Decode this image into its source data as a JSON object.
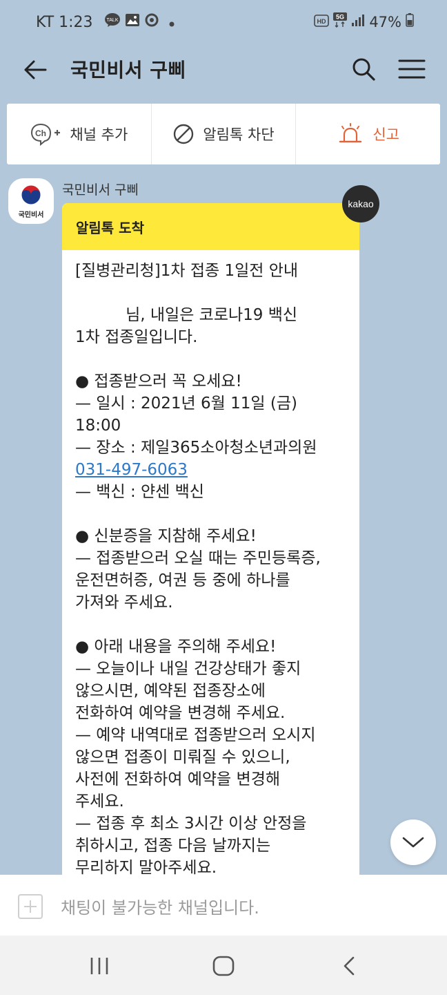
{
  "status_bar": {
    "carrier_time": "KT 1:23",
    "talk_label": "TALK",
    "hd_label": "HD",
    "network": "5G",
    "battery": "47%"
  },
  "header": {
    "title": "국민비서 구삐"
  },
  "actions": {
    "add_channel": "채널 추가",
    "ch_label": "Ch",
    "block": "알림톡 차단",
    "report": "신고"
  },
  "message": {
    "avatar_label": "국민비서",
    "sender": "국민비서 구삐",
    "badge": "kakao",
    "header": "알림톡 도착",
    "lines": [
      "[질병관리청]1차 접종 1일전 안내",
      "",
      "          님, 내일은 코로나19 백신",
      "1차 접종일입니다.",
      "",
      "● 접종받으러 꼭 오세요!",
      "— 일시 : 2021년 6월 11일 (금)",
      "18:00",
      "— 장소 : 제일365소아청소년과의원",
      "031-497-6063",
      "— 백신 : 얀센 백신",
      "",
      "● 신분증을 지참해 주세요!",
      "— 접종받으러 오실 때는 주민등록증,",
      "운전면허증, 여권 등 중에 하나를",
      "가져와 주세요.",
      "",
      "● 아래 내용을 주의해 주세요!",
      "— 오늘이나 내일 건강상태가 좋지",
      "않으시면, 예약된 접종장소에",
      "전화하여 예약을 변경해 주세요.",
      "— 예약 내역대로 접종받으러 오시지",
      "않으면 접종이 미뤄질 수 있으니,",
      "사전에 전화하여 예약을 변경해",
      "주세요.",
      "— 접종 후 최소 3시간 이상 안정을",
      "취하시고, 접종 다음 날까지는",
      "무리하지 말아주세요."
    ]
  },
  "input": {
    "placeholder": "채팅이 불가능한 채널입니다."
  },
  "colors": {
    "chat_background": "#b2c7da",
    "bubble_header": "#fee93b",
    "report_accent": "#e0633a",
    "link": "#2d78c9"
  }
}
